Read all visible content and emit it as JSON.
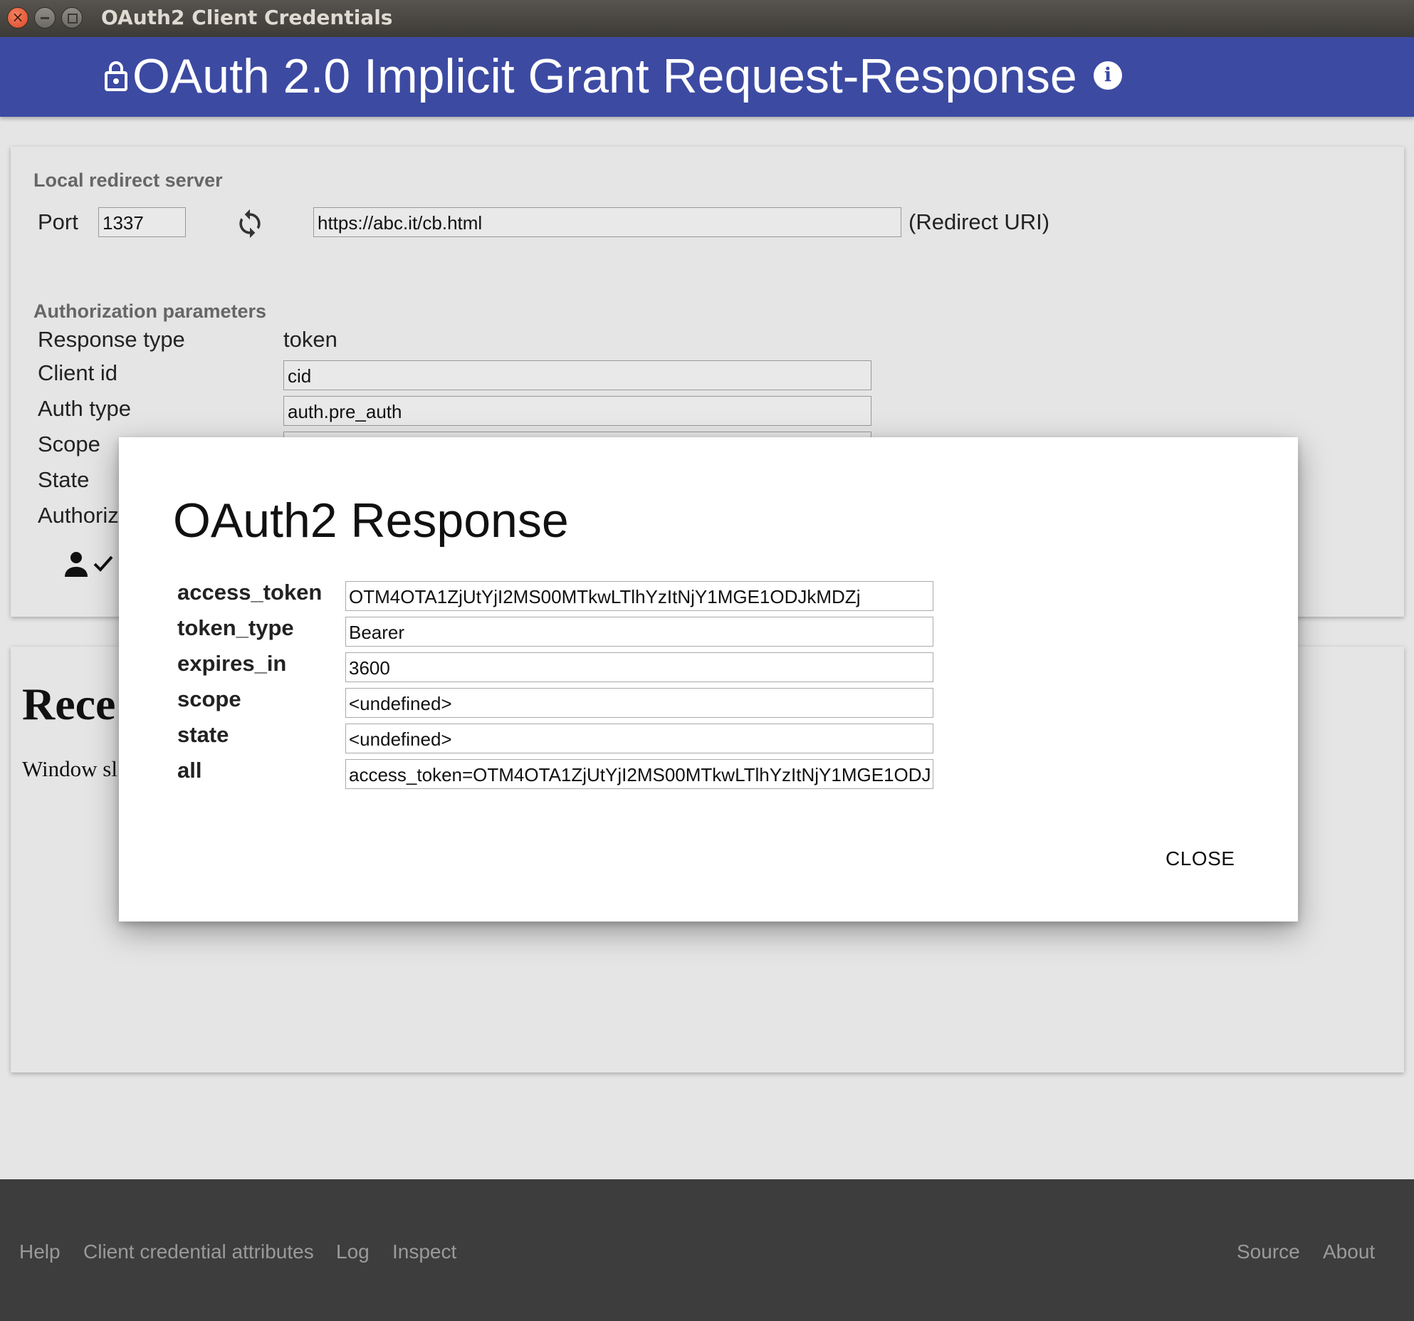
{
  "window": {
    "title": "OAuth2 Client Credentials"
  },
  "header": {
    "title": "OAuth 2.0 Implicit Grant Request-Response",
    "lock_icon": "lock-icon",
    "info_icon": "info-icon"
  },
  "redirect_server": {
    "section_title": "Local redirect server",
    "port_label": "Port",
    "port_value": "1337",
    "refresh_icon": "refresh-icon",
    "redirect_uri_value": "https://abc.it/cb.html",
    "redirect_uri_label": "(Redirect URI)"
  },
  "auth_params": {
    "section_title": "Authorization parameters",
    "response_type_label": "Response type",
    "response_type_value": "token",
    "client_id_label": "Client id",
    "client_id_value": "cid",
    "auth_type_label": "Auth type",
    "auth_type_value": "auth.pre_auth",
    "scope_label": "Scope",
    "state_label": "State",
    "authorize_label": "Authoriz"
  },
  "recent": {
    "title": "Rece",
    "subtitle": "Window sl"
  },
  "dialog": {
    "title": "OAuth2 Response",
    "rows": [
      {
        "key": "access_token",
        "value": "OTM4OTA1ZjUtYjI2MS00MTkwLTlhYzItNjY1MGE1ODJkMDZj"
      },
      {
        "key": "token_type",
        "value": "Bearer"
      },
      {
        "key": "expires_in",
        "value": "3600"
      },
      {
        "key": "scope",
        "value": "<undefined>"
      },
      {
        "key": "state",
        "value": "<undefined>"
      },
      {
        "key": "all",
        "value": "access_token=OTM4OTA1ZjUtYjI2MS00MTkwLTlhYzItNjY1MGE1ODJ"
      }
    ],
    "close_label": "CLOSE"
  },
  "footer": {
    "links_left": [
      "Help",
      "Client credential attributes",
      "Log",
      "Inspect"
    ],
    "links_right": [
      "Source",
      "About"
    ]
  },
  "colors": {
    "header_bg": "#3c4aa2",
    "footer_bg": "#3d3d3d",
    "page_bg": "#e5e5e5"
  }
}
